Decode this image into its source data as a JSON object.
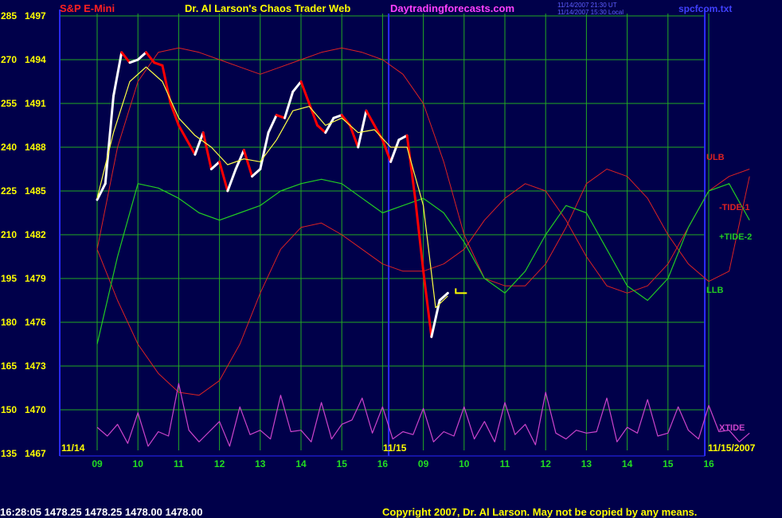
{
  "header": {
    "instrument": "S&P E-Mini",
    "title": "Dr. Al Larson's Chaos Trader Web",
    "site": "Daytradingforecasts.com",
    "time_ut": "11/14/2007 21:30 UT",
    "time_local": "11/14/2007 15:30 Local",
    "filename": "spcfcom.txt"
  },
  "footer": {
    "quote": "16:28:05  1478.25 1478.25 1478.00 1478.00",
    "copyright": "Copyright 2007, Dr. Al Larson. May not be copied by any means."
  },
  "colors": {
    "background": "#00004a",
    "grid": "#22aa22",
    "axis": "#2a2aff",
    "price_up": "#ffffff",
    "price_down": "#ff0000",
    "moving_avg": "#ffff44",
    "ulb": "#dd2222",
    "tide": "#22cc22",
    "xtide": "#cc44cc"
  },
  "chart_data": {
    "type": "line",
    "y_axis": {
      "labels_left": [
        "285",
        "270",
        "255",
        "240",
        "225",
        "210",
        "195",
        "180",
        "165",
        "150",
        "135"
      ],
      "labels_right": [
        "1497",
        "1494",
        "1491",
        "1488",
        "1485",
        "1482",
        "1479",
        "1476",
        "1473",
        "1470",
        "1467"
      ],
      "ylim": [
        1467,
        1497
      ]
    },
    "x_axis": {
      "hour_labels": [
        "09",
        "10",
        "11",
        "12",
        "13",
        "14",
        "15",
        "16",
        "09",
        "10",
        "11",
        "12",
        "13",
        "14",
        "15",
        "16"
      ],
      "date_labels": [
        "11/14",
        "11/15",
        "11/15/2007"
      ]
    },
    "series_labels": {
      "ulb": "ULB",
      "tide1": "-TIDE-1",
      "tide2": "+TIDE-2",
      "llb": "LLB",
      "xtide": "XTIDE"
    },
    "price": {
      "x": [
        0.0,
        0.2,
        0.4,
        0.6,
        0.8,
        1.0,
        1.2,
        1.4,
        1.6,
        1.8,
        2.0,
        2.2,
        2.4,
        2.6,
        2.8,
        3.0,
        3.2,
        3.4,
        3.6,
        3.8,
        4.0,
        4.2,
        4.4,
        4.6,
        4.8,
        5.0,
        5.2,
        5.4,
        5.6,
        5.8,
        6.0,
        6.2,
        6.4,
        6.6,
        6.8,
        7.0,
        7.2,
        7.4,
        7.6,
        7.8,
        8.0,
        8.2,
        8.4,
        8.6
      ],
      "y": [
        1484.4,
        1485.5,
        1491.5,
        1494.5,
        1493.8,
        1494.0,
        1494.5,
        1493.8,
        1493.6,
        1491.0,
        1489.5,
        1488.5,
        1487.5,
        1489.0,
        1486.5,
        1487.0,
        1485.0,
        1486.5,
        1487.8,
        1486.0,
        1486.5,
        1489.0,
        1490.2,
        1490.0,
        1491.8,
        1492.5,
        1491.0,
        1489.5,
        1489.0,
        1490.0,
        1490.2,
        1489.5,
        1488.0,
        1490.5,
        1489.5,
        1488.5,
        1487.0,
        1488.5,
        1488.8,
        1484.5,
        1479.5,
        1475.0,
        1477.5,
        1478.0
      ],
      "forecast_marker": 1478.0
    },
    "moving_average": {
      "x": [
        0.0,
        0.4,
        0.8,
        1.2,
        1.6,
        2.0,
        2.4,
        2.8,
        3.2,
        3.6,
        4.0,
        4.4,
        4.8,
        5.2,
        5.6,
        6.0,
        6.4,
        6.8,
        7.2,
        7.6,
        8.0,
        8.3,
        8.6
      ],
      "y": [
        1484.5,
        1489.0,
        1492.5,
        1493.5,
        1492.5,
        1490.0,
        1488.8,
        1488.0,
        1486.8,
        1487.2,
        1487.0,
        1488.5,
        1490.5,
        1490.8,
        1489.5,
        1490.0,
        1489.0,
        1489.2,
        1488.0,
        1488.0,
        1484.0,
        1477.0,
        1477.8
      ]
    },
    "ulb_line": {
      "x": [
        0.0,
        0.5,
        1.0,
        1.5,
        2.0,
        2.5,
        3.0,
        3.5,
        4.0,
        4.5,
        5.0,
        5.5,
        6.0,
        6.5,
        7.0,
        7.5,
        8.0,
        8.5,
        9.0,
        9.5,
        10.0,
        10.5,
        11.0,
        11.5,
        12.0,
        12.5,
        13.0,
        13.5,
        14.0,
        14.5,
        15.0,
        15.5,
        16.0
      ],
      "y": [
        1481.0,
        1488.0,
        1492.5,
        1494.5,
        1494.8,
        1494.5,
        1494.0,
        1493.5,
        1493.0,
        1493.5,
        1494.0,
        1494.5,
        1494.8,
        1494.5,
        1494.0,
        1493.0,
        1491.0,
        1487.0,
        1482.0,
        1479.0,
        1478.5,
        1478.5,
        1480.0,
        1482.5,
        1485.5,
        1486.5,
        1486.0,
        1484.5,
        1482.0,
        1480.0,
        1478.8,
        1479.5,
        1486.0
      ]
    },
    "tide2_line": {
      "x": [
        0.0,
        0.5,
        1.0,
        1.5,
        2.0,
        2.5,
        3.0,
        3.5,
        4.0,
        4.5,
        5.0,
        5.5,
        6.0,
        6.5,
        7.0,
        7.5,
        8.0,
        8.5,
        9.0,
        9.5,
        10.0,
        10.5,
        11.0,
        11.5,
        12.0,
        12.5,
        13.0,
        13.5,
        14.0,
        14.5,
        15.0,
        15.5,
        16.0
      ],
      "y": [
        1474.5,
        1480.5,
        1485.5,
        1485.2,
        1484.5,
        1483.5,
        1483.0,
        1483.5,
        1484.0,
        1485.0,
        1485.5,
        1485.8,
        1485.5,
        1484.5,
        1483.5,
        1484.0,
        1484.5,
        1483.5,
        1481.5,
        1479.0,
        1478.0,
        1479.5,
        1482.0,
        1484.0,
        1483.5,
        1481.0,
        1478.5,
        1477.5,
        1479.0,
        1482.5,
        1485.0,
        1485.5,
        1483.0
      ]
    },
    "llb_line": {
      "x": [
        0.0,
        0.5,
        1.0,
        1.5,
        2.0,
        2.5,
        3.0,
        3.5,
        4.0,
        4.5,
        5.0,
        5.5,
        6.0,
        6.5,
        7.0,
        7.5,
        8.0,
        8.5,
        9.0,
        9.5,
        10.0,
        10.5,
        11.0,
        11.5,
        12.0,
        12.5,
        13.0,
        13.5,
        14.0,
        14.5,
        15.0,
        15.5,
        16.0
      ],
      "y": [
        1481.0,
        1477.5,
        1474.5,
        1472.5,
        1471.2,
        1471.0,
        1472.0,
        1474.5,
        1478.0,
        1481.0,
        1482.5,
        1482.8,
        1482.0,
        1481.0,
        1480.0,
        1479.5,
        1479.5,
        1480.0,
        1481.0,
        1483.0,
        1484.5,
        1485.5,
        1485.0,
        1483.0,
        1480.5,
        1478.5,
        1478.0,
        1478.5,
        1480.0,
        1482.5,
        1485.0,
        1486.0,
        1486.5
      ]
    },
    "xtide_line": {
      "x": [
        0.0,
        0.25,
        0.5,
        0.75,
        1.0,
        1.25,
        1.5,
        1.75,
        2.0,
        2.25,
        2.5,
        2.75,
        3.0,
        3.25,
        3.5,
        3.75,
        4.0,
        4.25,
        4.5,
        4.75,
        5.0,
        5.25,
        5.5,
        5.75,
        6.0,
        6.25,
        6.5,
        6.75,
        7.0,
        7.25,
        7.5,
        7.75,
        8.0,
        8.25,
        8.5,
        8.75,
        9.0,
        9.25,
        9.5,
        9.75,
        10.0,
        10.25,
        10.5,
        10.75,
        11.0,
        11.25,
        11.5,
        11.75,
        12.0,
        12.25,
        12.5,
        12.75,
        13.0,
        13.25,
        13.5,
        13.75,
        14.0,
        14.25,
        14.5,
        14.75,
        15.0,
        15.25,
        15.5,
        15.75,
        16.0
      ],
      "y": [
        1468.8,
        1468.2,
        1469.0,
        1467.7,
        1469.8,
        1467.5,
        1468.5,
        1468.2,
        1471.8,
        1468.6,
        1467.8,
        1468.5,
        1469.2,
        1467.5,
        1470.2,
        1468.3,
        1468.6,
        1468.0,
        1471.0,
        1468.5,
        1468.6,
        1467.8,
        1470.5,
        1468.0,
        1469.0,
        1469.3,
        1470.8,
        1468.4,
        1470.2,
        1468.0,
        1468.5,
        1468.3,
        1470.1,
        1467.8,
        1468.5,
        1468.2,
        1470.2,
        1468.0,
        1469.2,
        1467.8,
        1470.5,
        1468.3,
        1469.0,
        1467.6,
        1471.2,
        1468.4,
        1468.0,
        1468.6,
        1468.4,
        1468.5,
        1470.8,
        1467.8,
        1468.8,
        1468.4,
        1470.7,
        1468.2,
        1468.4,
        1470.2,
        1468.6,
        1468.0,
        1470.3,
        1468.5,
        1468.6,
        1467.8,
        1468.4
      ]
    }
  }
}
